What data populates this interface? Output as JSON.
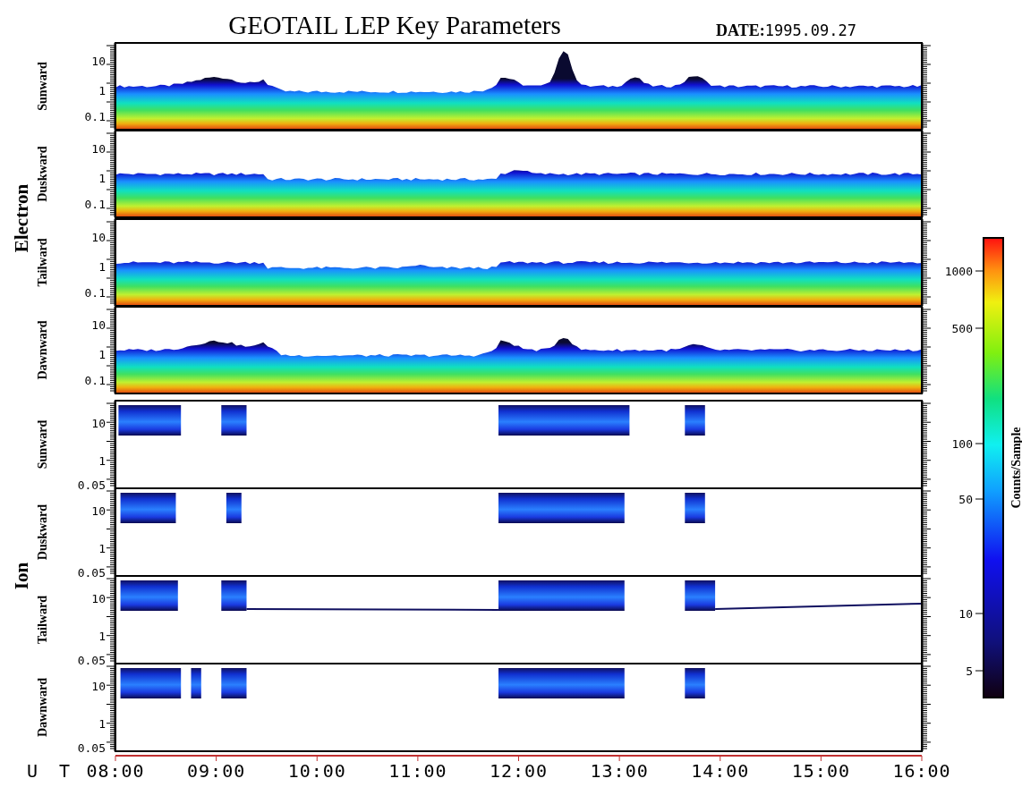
{
  "title": "GEOTAIL LEP Key Parameters",
  "date_label": "DATE:",
  "date": "1995.09.27",
  "groups": [
    {
      "label": "Electron",
      "kind": "electron",
      "panels": [
        {
          "label": "Sunward",
          "yticks": [
            "10",
            "1",
            "0.1"
          ]
        },
        {
          "label": "Duskward",
          "yticks": [
            "10",
            "1",
            "0.1"
          ]
        },
        {
          "label": "Tailward",
          "yticks": [
            "10",
            "1",
            "0.1"
          ]
        },
        {
          "label": "Dawnward",
          "yticks": [
            "10",
            "1",
            "0.1"
          ]
        }
      ]
    },
    {
      "label": "Ion",
      "kind": "ion",
      "panels": [
        {
          "label": "Sunward",
          "yticks": [
            "10",
            "1",
            "0.05"
          ]
        },
        {
          "label": "Duskward",
          "yticks": [
            "10",
            "1",
            "0.05"
          ]
        },
        {
          "label": "Tailward",
          "yticks": [
            "10",
            "1",
            "0.05"
          ]
        },
        {
          "label": "Dawnward",
          "yticks": [
            "10",
            "1",
            "0.05"
          ]
        }
      ]
    }
  ],
  "colorbar": {
    "label": "Counts/Sample",
    "ticks": [
      "1000",
      "500",
      "100",
      "50",
      "10",
      "5"
    ]
  },
  "time_axis": {
    "label": "U T",
    "ticks": [
      "08:00",
      "09:00",
      "10:00",
      "11:00",
      "12:00",
      "13:00",
      "14:00",
      "15:00",
      "16:00"
    ]
  }
}
